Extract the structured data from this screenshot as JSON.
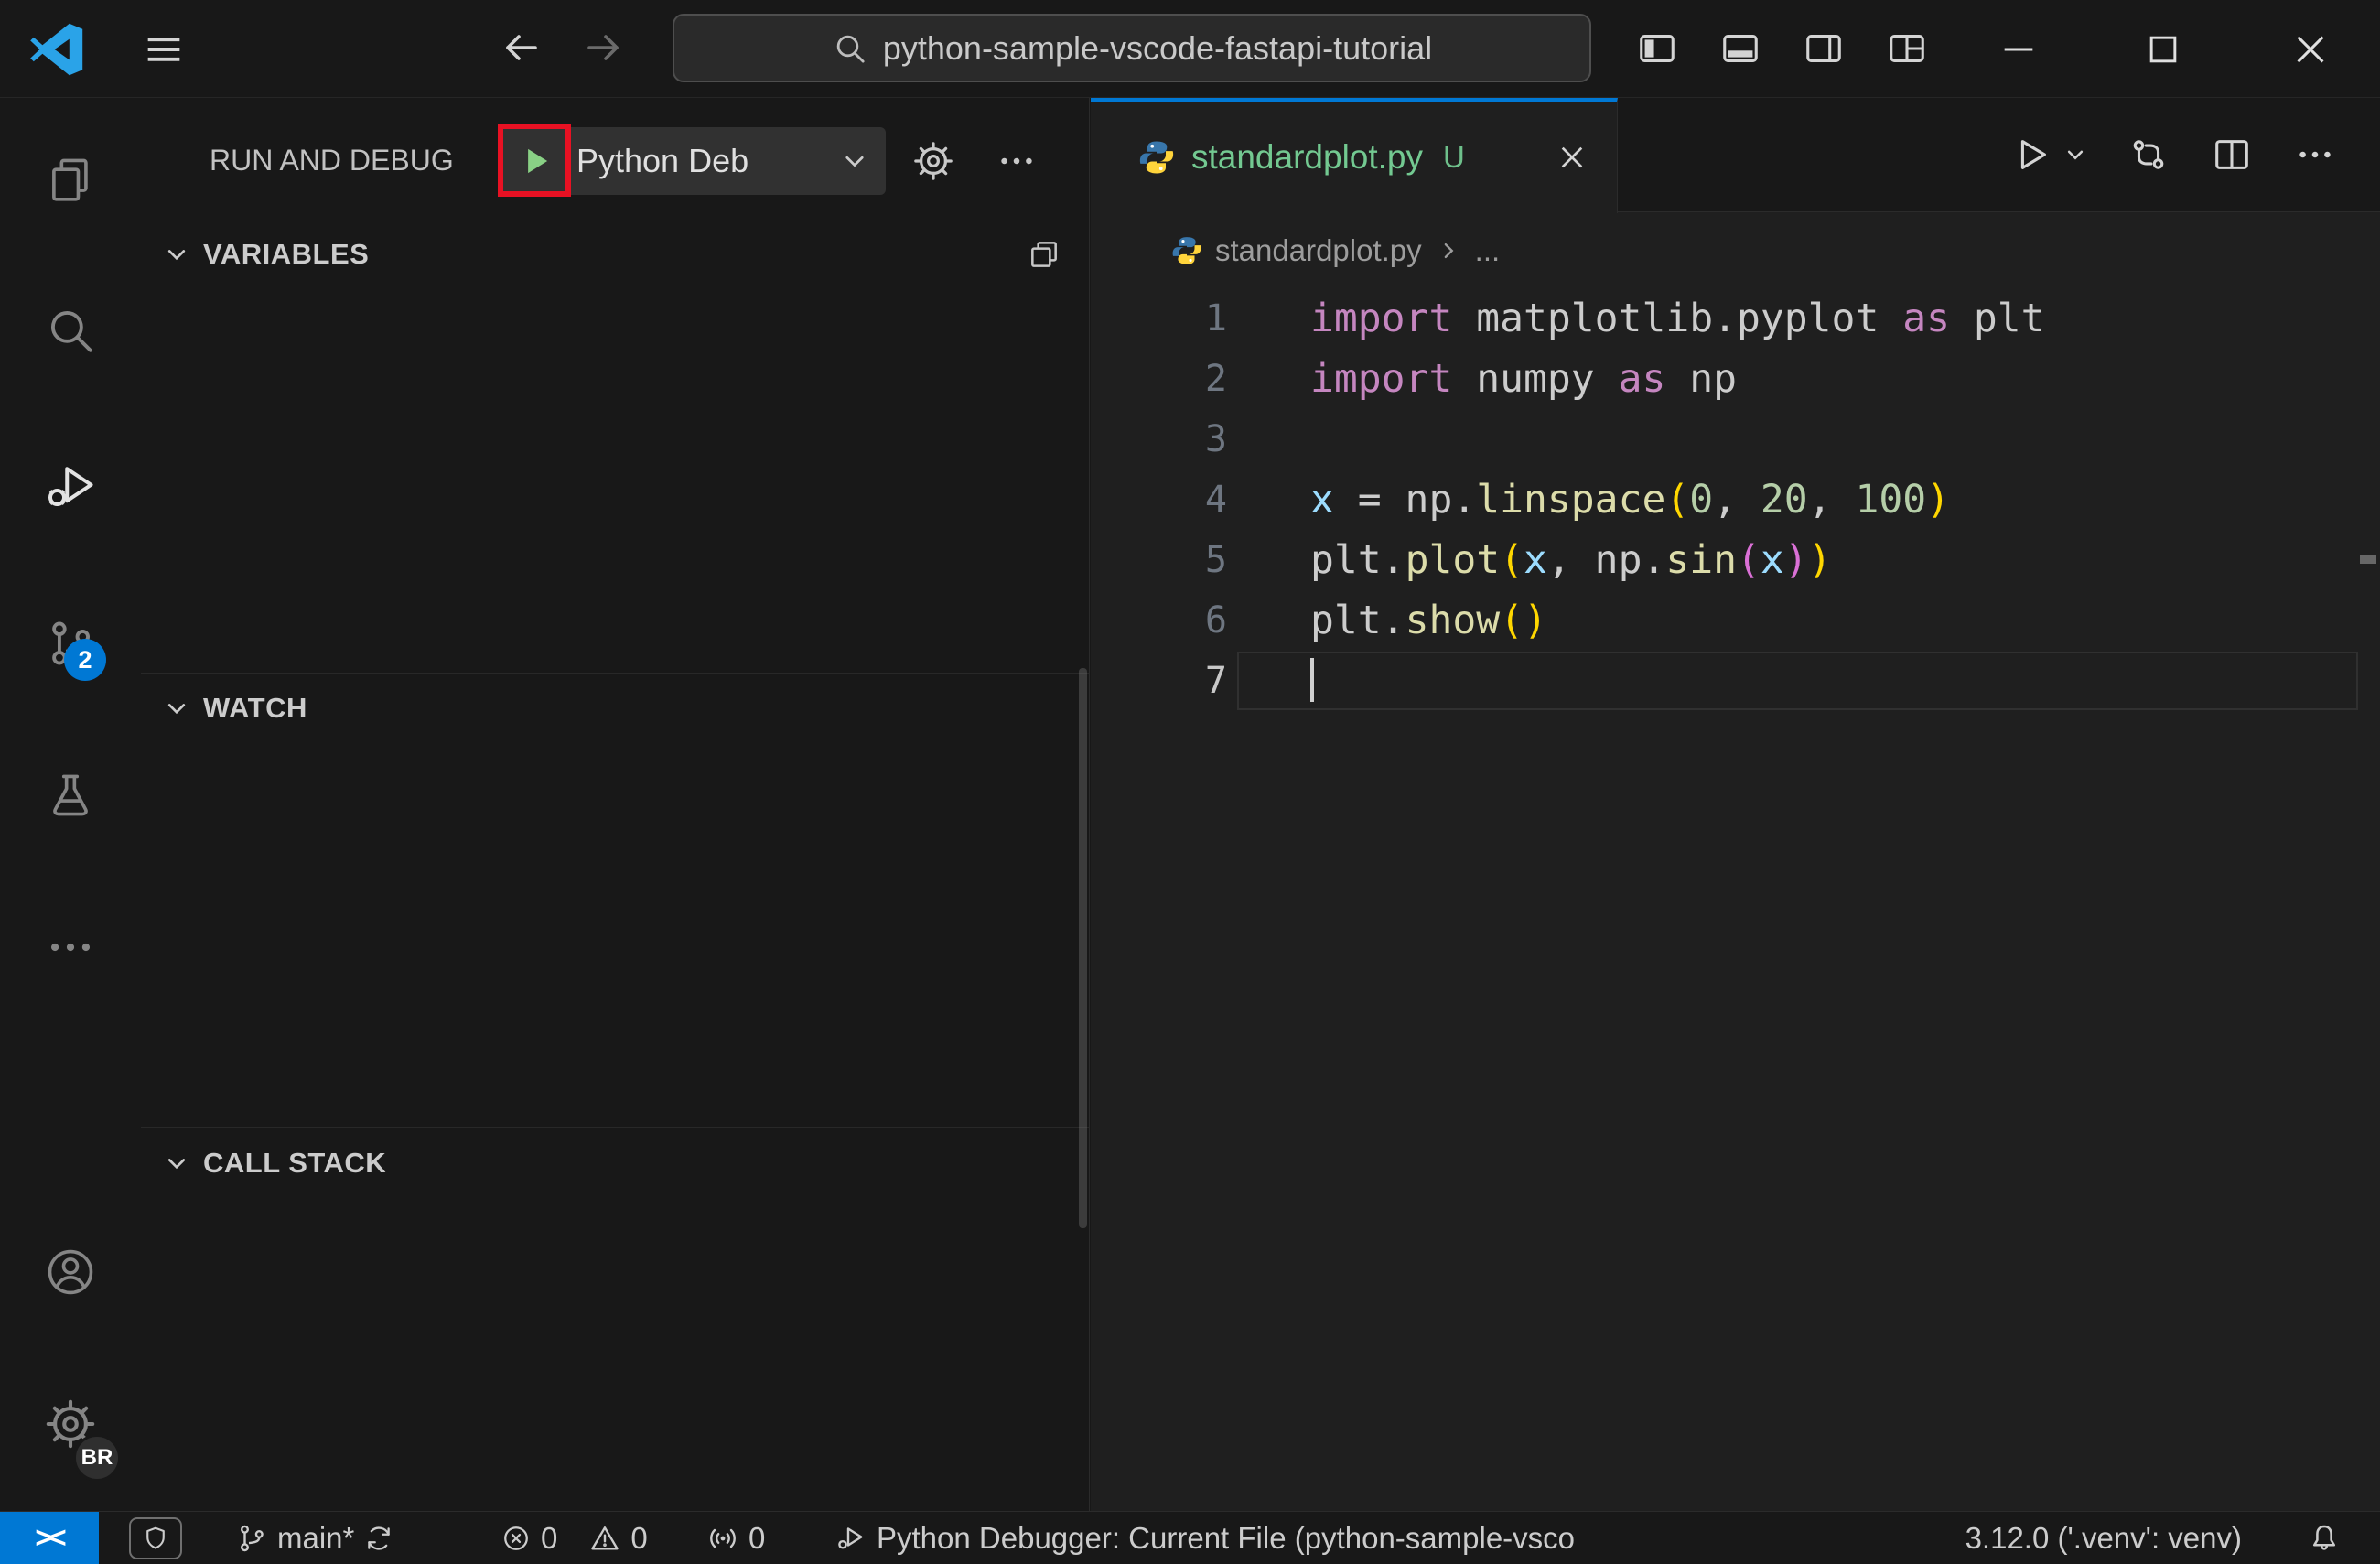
{
  "window": {
    "search_text": "python-sample-vscode-fastapi-tutorial"
  },
  "activity_bar": {
    "scm_badge": "2",
    "profile_badge": "BR"
  },
  "sidebar": {
    "title": "RUN AND DEBUG",
    "config_label": "Python Deb",
    "variables_label": "VARIABLES",
    "watch_label": "WATCH",
    "call_stack_label": "CALL STACK"
  },
  "editor": {
    "tab_label": "standardplot.py",
    "tab_dirty": "U",
    "breadcrumb_file": "standardplot.py",
    "breadcrumb_more": "...",
    "code_lines": [
      {
        "tokens": [
          {
            "c": "kw",
            "t": "import"
          },
          {
            "c": "fg",
            "t": " matplotlib.pyplot "
          },
          {
            "c": "kw",
            "t": "as"
          },
          {
            "c": "fg",
            "t": " plt"
          }
        ]
      },
      {
        "tokens": [
          {
            "c": "kw",
            "t": "import"
          },
          {
            "c": "fg",
            "t": " numpy "
          },
          {
            "c": "kw",
            "t": "as"
          },
          {
            "c": "fg",
            "t": " np"
          }
        ]
      },
      {
        "tokens": []
      },
      {
        "tokens": [
          {
            "c": "var",
            "t": "x"
          },
          {
            "c": "fg",
            "t": " = np."
          },
          {
            "c": "fn",
            "t": "linspace"
          },
          {
            "c": "br1",
            "t": "("
          },
          {
            "c": "num",
            "t": "0"
          },
          {
            "c": "fg",
            "t": ", "
          },
          {
            "c": "num",
            "t": "20"
          },
          {
            "c": "fg",
            "t": ", "
          },
          {
            "c": "num",
            "t": "100"
          },
          {
            "c": "br1",
            "t": ")"
          }
        ]
      },
      {
        "tokens": [
          {
            "c": "fg",
            "t": "plt."
          },
          {
            "c": "fn",
            "t": "plot"
          },
          {
            "c": "br1",
            "t": "("
          },
          {
            "c": "var",
            "t": "x"
          },
          {
            "c": "fg",
            "t": ", np."
          },
          {
            "c": "fn",
            "t": "sin"
          },
          {
            "c": "br2",
            "t": "("
          },
          {
            "c": "var",
            "t": "x"
          },
          {
            "c": "br2",
            "t": ")"
          },
          {
            "c": "br1",
            "t": ")"
          }
        ]
      },
      {
        "tokens": [
          {
            "c": "fg",
            "t": "plt."
          },
          {
            "c": "fn",
            "t": "show"
          },
          {
            "c": "br1",
            "t": "("
          },
          {
            "c": "br1",
            "t": ")"
          }
        ]
      },
      {
        "tokens": [],
        "current": true,
        "cursor": true
      }
    ]
  },
  "status_bar": {
    "remote_glyph": "><",
    "branch_label": "main*",
    "error_count": "0",
    "warning_count": "0",
    "ports_count": "0",
    "debug_label": "Python Debugger: Current File (python-sample-vsco",
    "python_version": "3.12.0 ('.venv': venv)"
  },
  "colors": {
    "accent": "#0078d4",
    "untracked_green": "#73c991",
    "annotation_red": "#e81123",
    "run_green": "#89d185"
  }
}
